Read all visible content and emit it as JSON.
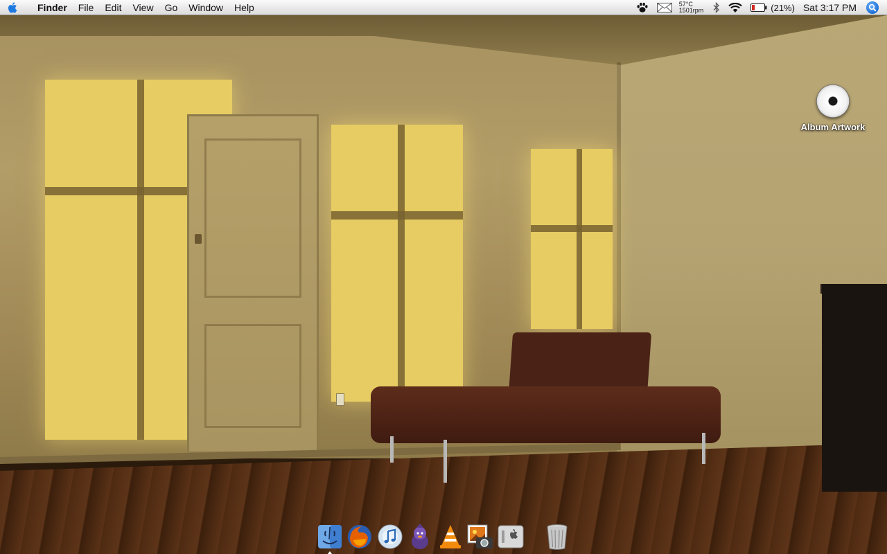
{
  "menubar": {
    "apple_icon": "apple-icon",
    "app_name": "Finder",
    "menus": [
      "File",
      "Edit",
      "View",
      "Go",
      "Window",
      "Help"
    ],
    "status": {
      "growl_icon": "paw-icon",
      "mail_icon": "mail-icon",
      "temperature": "57°C",
      "fan_speed": "1501rpm",
      "bluetooth_icon": "bluetooth-icon",
      "wifi_icon": "wifi-icon",
      "battery_icon": "battery-icon",
      "battery_percent": "(21%)",
      "clock": "Sat 3:17 PM",
      "spotlight_icon": "spotlight-icon"
    }
  },
  "desktop": {
    "icons": [
      {
        "label": "Album Artwork",
        "icon": "cd-icon"
      }
    ]
  },
  "dock": {
    "items": [
      {
        "name": "finder",
        "icon": "finder-icon",
        "running": true
      },
      {
        "name": "firefox",
        "icon": "firefox-icon",
        "running": false
      },
      {
        "name": "itunes",
        "icon": "itunes-icon",
        "running": false
      },
      {
        "name": "adium",
        "icon": "adium-icon",
        "running": false
      },
      {
        "name": "vlc",
        "icon": "vlc-icon",
        "running": false
      },
      {
        "name": "preview",
        "icon": "preview-icon",
        "running": false
      },
      {
        "name": "system-preferences",
        "icon": "system-preferences-icon",
        "running": false
      },
      {
        "name": "trash",
        "icon": "trash-icon",
        "running": false
      }
    ]
  },
  "colors": {
    "apple_blue": "#1f7ae0",
    "battery_red": "#d22a22",
    "spotlight_blue": "#1d6fd6"
  }
}
